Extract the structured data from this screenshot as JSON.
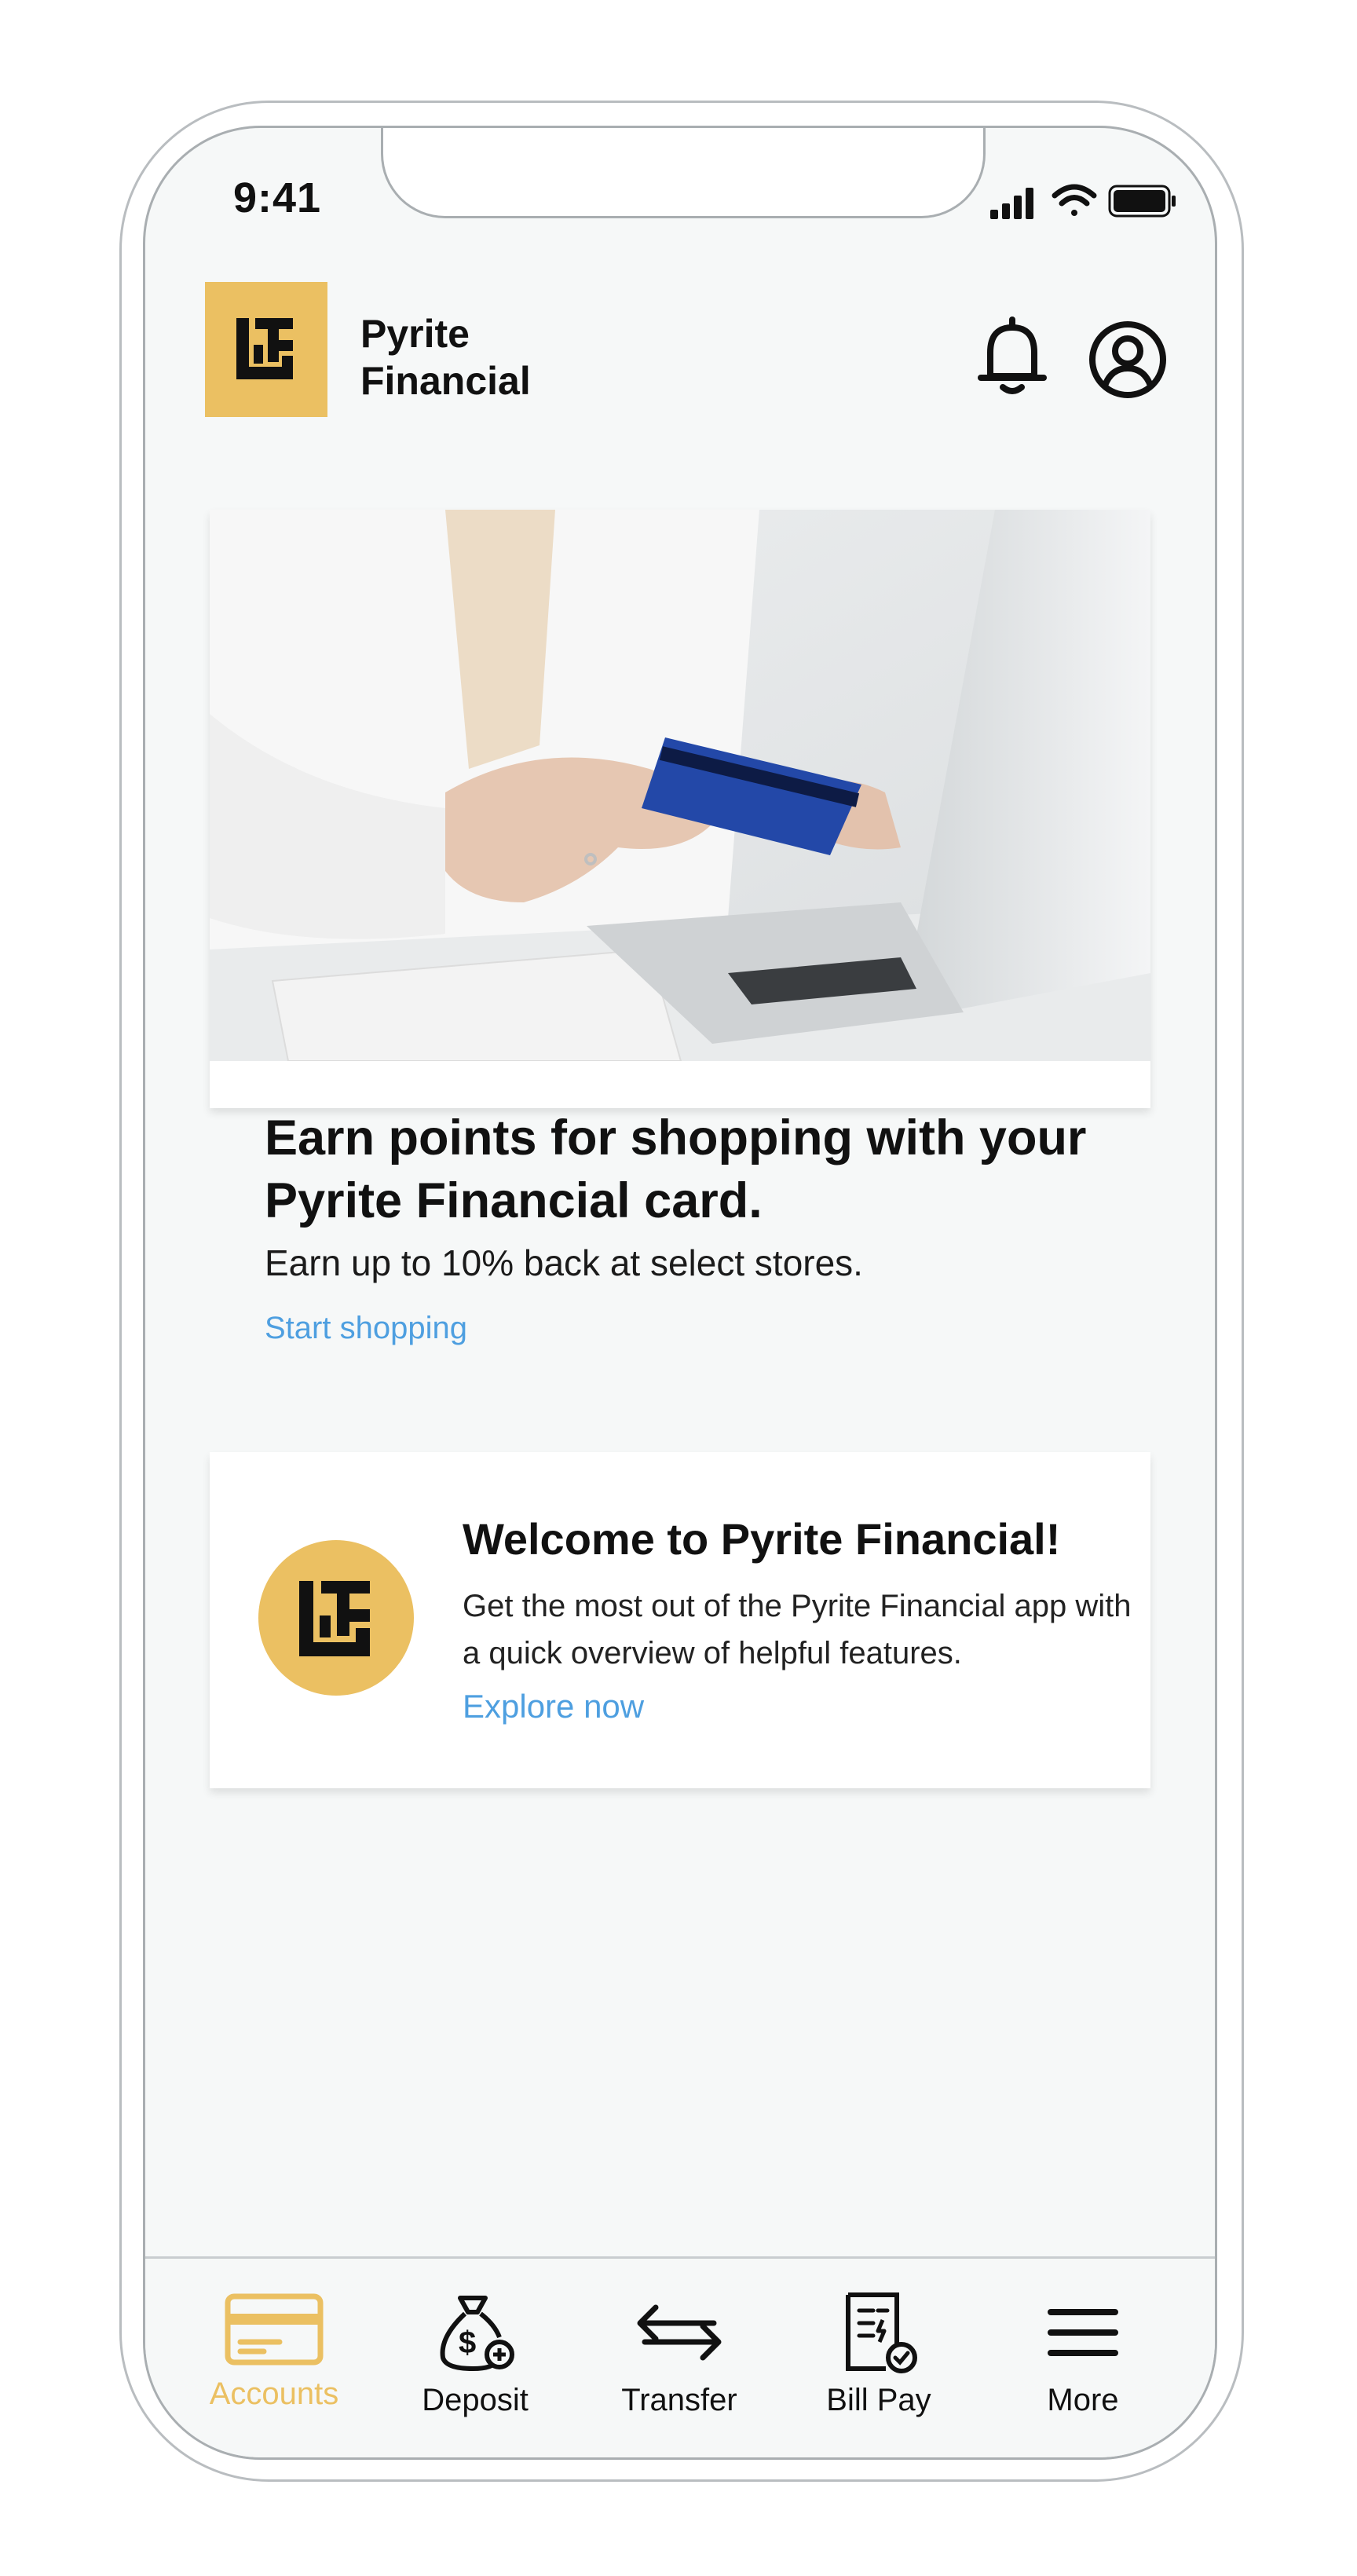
{
  "status_bar": {
    "time": "9:41"
  },
  "header": {
    "brand_line1": "Pyrite",
    "brand_line2": "Financial",
    "logo_icon": "pyrite-logo-icon",
    "bell_icon": "bell-icon",
    "profile_icon": "profile-icon"
  },
  "promo_card": {
    "title": "Earn points for shopping with your Pyrite Financial card.",
    "subtitle": "Earn up to 10% back at select stores.",
    "link": "Start shopping"
  },
  "welcome_card": {
    "title": "Welcome to Pyrite Financial!",
    "body": "Get the most out of the Pyrite Financial app with a quick overview of helpful features.",
    "link": "Explore now"
  },
  "tabs": [
    {
      "label": "Accounts",
      "icon": "card-icon",
      "active": true
    },
    {
      "label": "Deposit",
      "icon": "money-bag-icon",
      "active": false
    },
    {
      "label": "Transfer",
      "icon": "transfer-arrows-icon",
      "active": false
    },
    {
      "label": "Bill Pay",
      "icon": "bill-icon",
      "active": false
    },
    {
      "label": "More",
      "icon": "menu-icon",
      "active": false
    }
  ],
  "colors": {
    "brand_gold": "#EBC062",
    "link_blue": "#4E9FE0",
    "screen_bg": "#F6F8F8",
    "text_dark": "#111111"
  }
}
